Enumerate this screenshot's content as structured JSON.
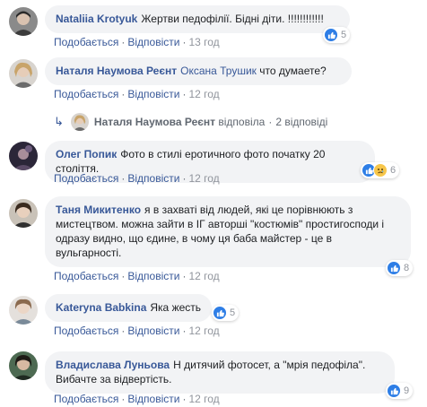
{
  "actions": {
    "like": "Подобається",
    "reply": "Відповісти",
    "sep": "·"
  },
  "comments": [
    {
      "author": "Nataliia Krotyuk",
      "text": "Жертви педофілії. Бідні діти. !!!!!!!!!!!!",
      "time": "13 год",
      "reactions": "5"
    },
    {
      "author": "Наталя Наумова Реєнт",
      "mention": "Оксана Трушик",
      "text": "что думаете?",
      "time": "12 год"
    },
    {
      "author": "Олег Попик",
      "text": "Фото в стилі еротичного фото початку 20 століття.",
      "time": "12 год",
      "reactions": "6"
    },
    {
      "author": "Таня Микитенко",
      "text": "я в захваті від людей, які це порівнюють з мистецтвом. можна зайти в ІГ авторші \"костюмів\" простигосподи і одразу видно, що єдине, в чому ця баба майстер - це в вульгарності.",
      "time": "12 год",
      "reactions": "8"
    },
    {
      "author": "Kateryna Babkina",
      "text": "Яка жесть",
      "time": "12 год",
      "reactions": "5"
    },
    {
      "author": "Владислава Луньова",
      "text": "Н дитячий фотосет, а \"мрія педофіла\". Вибачте за відвертість.",
      "time": "12 год",
      "reactions": "9"
    }
  ],
  "reply_summary": {
    "author": "Наталя Наумова Реєнт",
    "action": "відповіла",
    "count": "2 відповіді"
  }
}
